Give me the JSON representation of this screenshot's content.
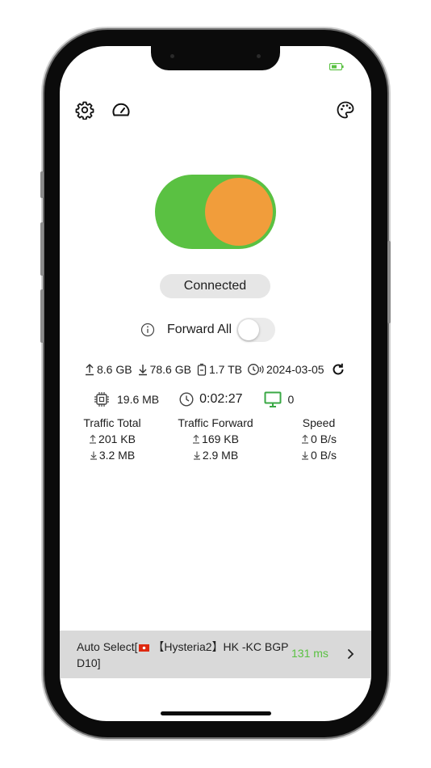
{
  "status": {
    "label": "Connected"
  },
  "forward_all": {
    "label": "Forward All",
    "enabled": false
  },
  "usage": {
    "upload": "8.6 GB",
    "download": "78.6 GB",
    "total": "1.7 TB",
    "expiry": "2024-03-05"
  },
  "stats": {
    "memory": "19.6 MB",
    "duration": "0:02:27",
    "connections": "0"
  },
  "traffic": {
    "total": {
      "label": "Traffic Total",
      "up": "201 KB",
      "down": "3.2 MB"
    },
    "forward": {
      "label": "Traffic Forward",
      "up": "169 KB",
      "down": "2.9 MB"
    },
    "speed": {
      "label": "Speed",
      "up": "0 B/s",
      "down": "0 B/s"
    }
  },
  "server": {
    "name_prefix": "Auto Select[",
    "name_suffix": " 【Hysteria2】HK -KC BGP D10]",
    "flag": "hong-kong-flag",
    "latency": "131 ms"
  },
  "colors": {
    "accent_green": "#5ac142",
    "knob_orange": "#f19d3b",
    "monitor_green": "#3aa845"
  },
  "icons": {
    "settings": "gear-icon",
    "speed": "speedometer-icon",
    "theme": "palette-icon",
    "info": "info-icon",
    "refresh": "refresh-icon"
  }
}
